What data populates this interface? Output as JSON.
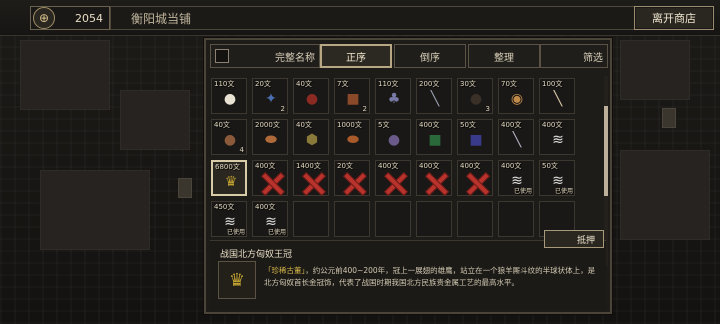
{
  "topbar": {
    "coin_icon": "coin-icon",
    "money": "2054",
    "shop_name": "衡阳城当铺",
    "leave_label": "离开商店"
  },
  "toolbar": {
    "full_name_label": "完整名称",
    "asc_label": "正序",
    "desc_label": "倒序",
    "organize_label": "整理",
    "filter_label": "筛选"
  },
  "grid": {
    "rows": [
      [
        {
          "price": "110文",
          "icon": "pearl-icon",
          "glyph": "●",
          "color": "#e8e2d2",
          "qty": "",
          "sold": false,
          "used": false
        },
        {
          "price": "20文",
          "icon": "blue-cloth-icon",
          "glyph": "✦",
          "color": "#4a6fb0",
          "qty": "2",
          "sold": false,
          "used": false
        },
        {
          "price": "40文",
          "icon": "red-gourd-icon",
          "glyph": "●",
          "color": "#8a2a22",
          "qty": "",
          "sold": false,
          "used": false
        },
        {
          "price": "7文",
          "icon": "block-icon",
          "glyph": "■",
          "color": "#8a4a2a",
          "qty": "2",
          "sold": false,
          "used": false
        },
        {
          "price": "110文",
          "icon": "bottles-icon",
          "glyph": "♣",
          "color": "#7a7aa8",
          "qty": "",
          "sold": false,
          "used": false
        },
        {
          "price": "200文",
          "icon": "sword-icon",
          "glyph": "╲",
          "color": "#9aa0b0",
          "qty": "",
          "sold": false,
          "used": false
        },
        {
          "price": "30文",
          "icon": "ball-icon",
          "glyph": "●",
          "color": "#3a3028",
          "qty": "3",
          "sold": false,
          "used": false
        },
        {
          "price": "70文",
          "icon": "drum-icon",
          "glyph": "◉",
          "color": "#c08a4a",
          "qty": "",
          "sold": false,
          "used": false
        },
        {
          "price": "100文",
          "icon": "scroll-icon",
          "glyph": "╲",
          "color": "#d8c8a8",
          "qty": "",
          "sold": false,
          "used": false
        }
      ],
      [
        {
          "price": "40文",
          "icon": "bell-icon",
          "glyph": "●",
          "color": "#8a5a3a",
          "qty": "4",
          "sold": false,
          "used": false
        },
        {
          "price": "2000文",
          "icon": "sausage-icon",
          "glyph": "⬬",
          "color": "#b06a3a",
          "qty": "",
          "sold": false,
          "used": false
        },
        {
          "price": "40文",
          "icon": "shield-icon",
          "glyph": "⬢",
          "color": "#8a7a3a",
          "qty": "",
          "sold": false,
          "used": false
        },
        {
          "price": "1000文",
          "icon": "meat-icon",
          "glyph": "⬬",
          "color": "#a85a2a",
          "qty": "",
          "sold": false,
          "used": false
        },
        {
          "price": "5文",
          "icon": "pot-icon",
          "glyph": "●",
          "color": "#6a5a8a",
          "qty": "",
          "sold": false,
          "used": false
        },
        {
          "price": "400文",
          "icon": "green-book-icon",
          "glyph": "■",
          "color": "#2a6a3a",
          "qty": "",
          "sold": false,
          "used": false
        },
        {
          "price": "50文",
          "icon": "blue-book-icon",
          "glyph": "■",
          "color": "#3a3a8a",
          "qty": "",
          "sold": false,
          "used": false
        },
        {
          "price": "400文",
          "icon": "blade-icon",
          "glyph": "╲",
          "color": "#b0b0c0",
          "qty": "",
          "sold": false,
          "used": false
        },
        {
          "price": "400文",
          "icon": "feather-icon",
          "glyph": "≋",
          "color": "#e0e0e0",
          "qty": "",
          "sold": false,
          "used": false
        }
      ],
      [
        {
          "price": "6800文",
          "icon": "crown-icon",
          "glyph": "♛",
          "color": "#c0a030",
          "qty": "",
          "sold": false,
          "used": false
        },
        {
          "price": "400文",
          "icon": "sold-out-icon",
          "glyph": "",
          "color": "",
          "qty": "",
          "sold": true,
          "used": false
        },
        {
          "price": "1400文",
          "icon": "sold-out-icon",
          "glyph": "",
          "color": "",
          "qty": "",
          "sold": true,
          "used": false
        },
        {
          "price": "20文",
          "icon": "sold-out-icon",
          "glyph": "",
          "color": "",
          "qty": "",
          "sold": true,
          "used": false
        },
        {
          "price": "400文",
          "icon": "sold-out-icon",
          "glyph": "",
          "color": "",
          "qty": "",
          "sold": true,
          "used": false
        },
        {
          "price": "400文",
          "icon": "sold-out-icon",
          "glyph": "",
          "color": "",
          "qty": "",
          "sold": true,
          "used": false
        },
        {
          "price": "400文",
          "icon": "sold-out-icon",
          "glyph": "",
          "color": "",
          "qty": "",
          "sold": true,
          "used": false
        },
        {
          "price": "400文",
          "icon": "feather-icon",
          "glyph": "≋",
          "color": "#e0e0e0",
          "qty": "",
          "sold": false,
          "used": true,
          "used_label": "已使用"
        },
        {
          "price": "50文",
          "icon": "feather-icon",
          "glyph": "≋",
          "color": "#e0e0e0",
          "qty": "",
          "sold": false,
          "used": true,
          "used_label": "已使用"
        }
      ],
      [
        {
          "price": "450文",
          "icon": "fan-icon",
          "glyph": "≋",
          "color": "#e0e0e0",
          "qty": "",
          "sold": false,
          "used": true,
          "used_label": "已使用"
        },
        {
          "price": "400文",
          "icon": "feather-icon",
          "glyph": "≋",
          "color": "#e0e0e0",
          "qty": "",
          "sold": false,
          "used": true,
          "used_label": "已使用"
        }
      ]
    ]
  },
  "sell_label": "抵押",
  "detail": {
    "name": "战国北方匈奴王冠",
    "icon": "crown-icon",
    "tag": "「珍稀古董」",
    "text": "，约公元前400~200年，冠上一展翅的雄鹰，站立在一个狼羊厮斗纹的半球状体上，是北方匈奴首长金冠饰，代表了战国时期我国北方民族贵金属工艺的最高水平。"
  }
}
